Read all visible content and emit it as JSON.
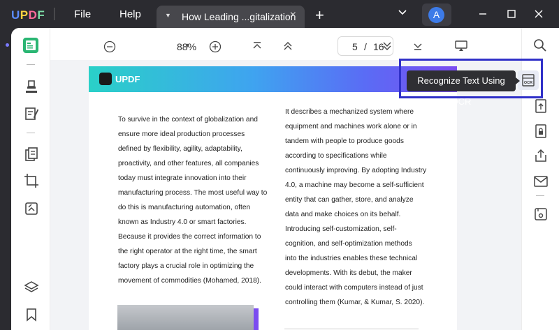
{
  "app": {
    "logo_text": "UPDF",
    "menu": [
      "File",
      "Help"
    ],
    "tab_title": "How Leading ...gitalization",
    "avatar_initial": "A"
  },
  "toolbar": {
    "zoom": "88%",
    "current_page": "5",
    "page_separator": "/",
    "total_pages": "16"
  },
  "tooltip": {
    "text": "Recognize Text Using OCR"
  },
  "page": {
    "banner_logo_text": "UPDF",
    "left_column": [
      "To survive in the context of globalization and",
      "ensure more ideal production processes",
      "defined by flexibility, agility, adaptability,",
      "proactivity, and other features, all companies",
      "today must integrate innovation into their",
      "manufacturing process. The most useful way to",
      "do this is manufacturing automation, often",
      "known as Industry 4.0 or smart factories.",
      "Because it provides the correct information to",
      "the right operator at the right time, the smart",
      "factory plays a crucial role in optimizing the",
      "movement of commodities (Mohamed, 2018)."
    ],
    "right_column": [
      "It describes a mechanized system where",
      "equipment and machines work alone or in",
      "tandem with people to produce goods",
      "according to specifications while",
      "continuously improving. By adopting Industry",
      "4.0, a machine may become a self-sufficient",
      "entity that can gather, store, and analyze",
      "data and make choices on its behalf.",
      "Introducing self-customization, self-",
      "cognition, and self-optimization methods",
      "into the industries enables these technical",
      "developments. With its debut, the maker",
      "could interact with computers instead of just",
      "controlling them (Kumar, & Kumar, S. 2020)."
    ]
  },
  "colors": {
    "accent": "#3030c8",
    "banner_gradient_start": "#2ad0c8",
    "banner_gradient_end": "#7b4cf0",
    "avatar": "#3d7be8"
  }
}
